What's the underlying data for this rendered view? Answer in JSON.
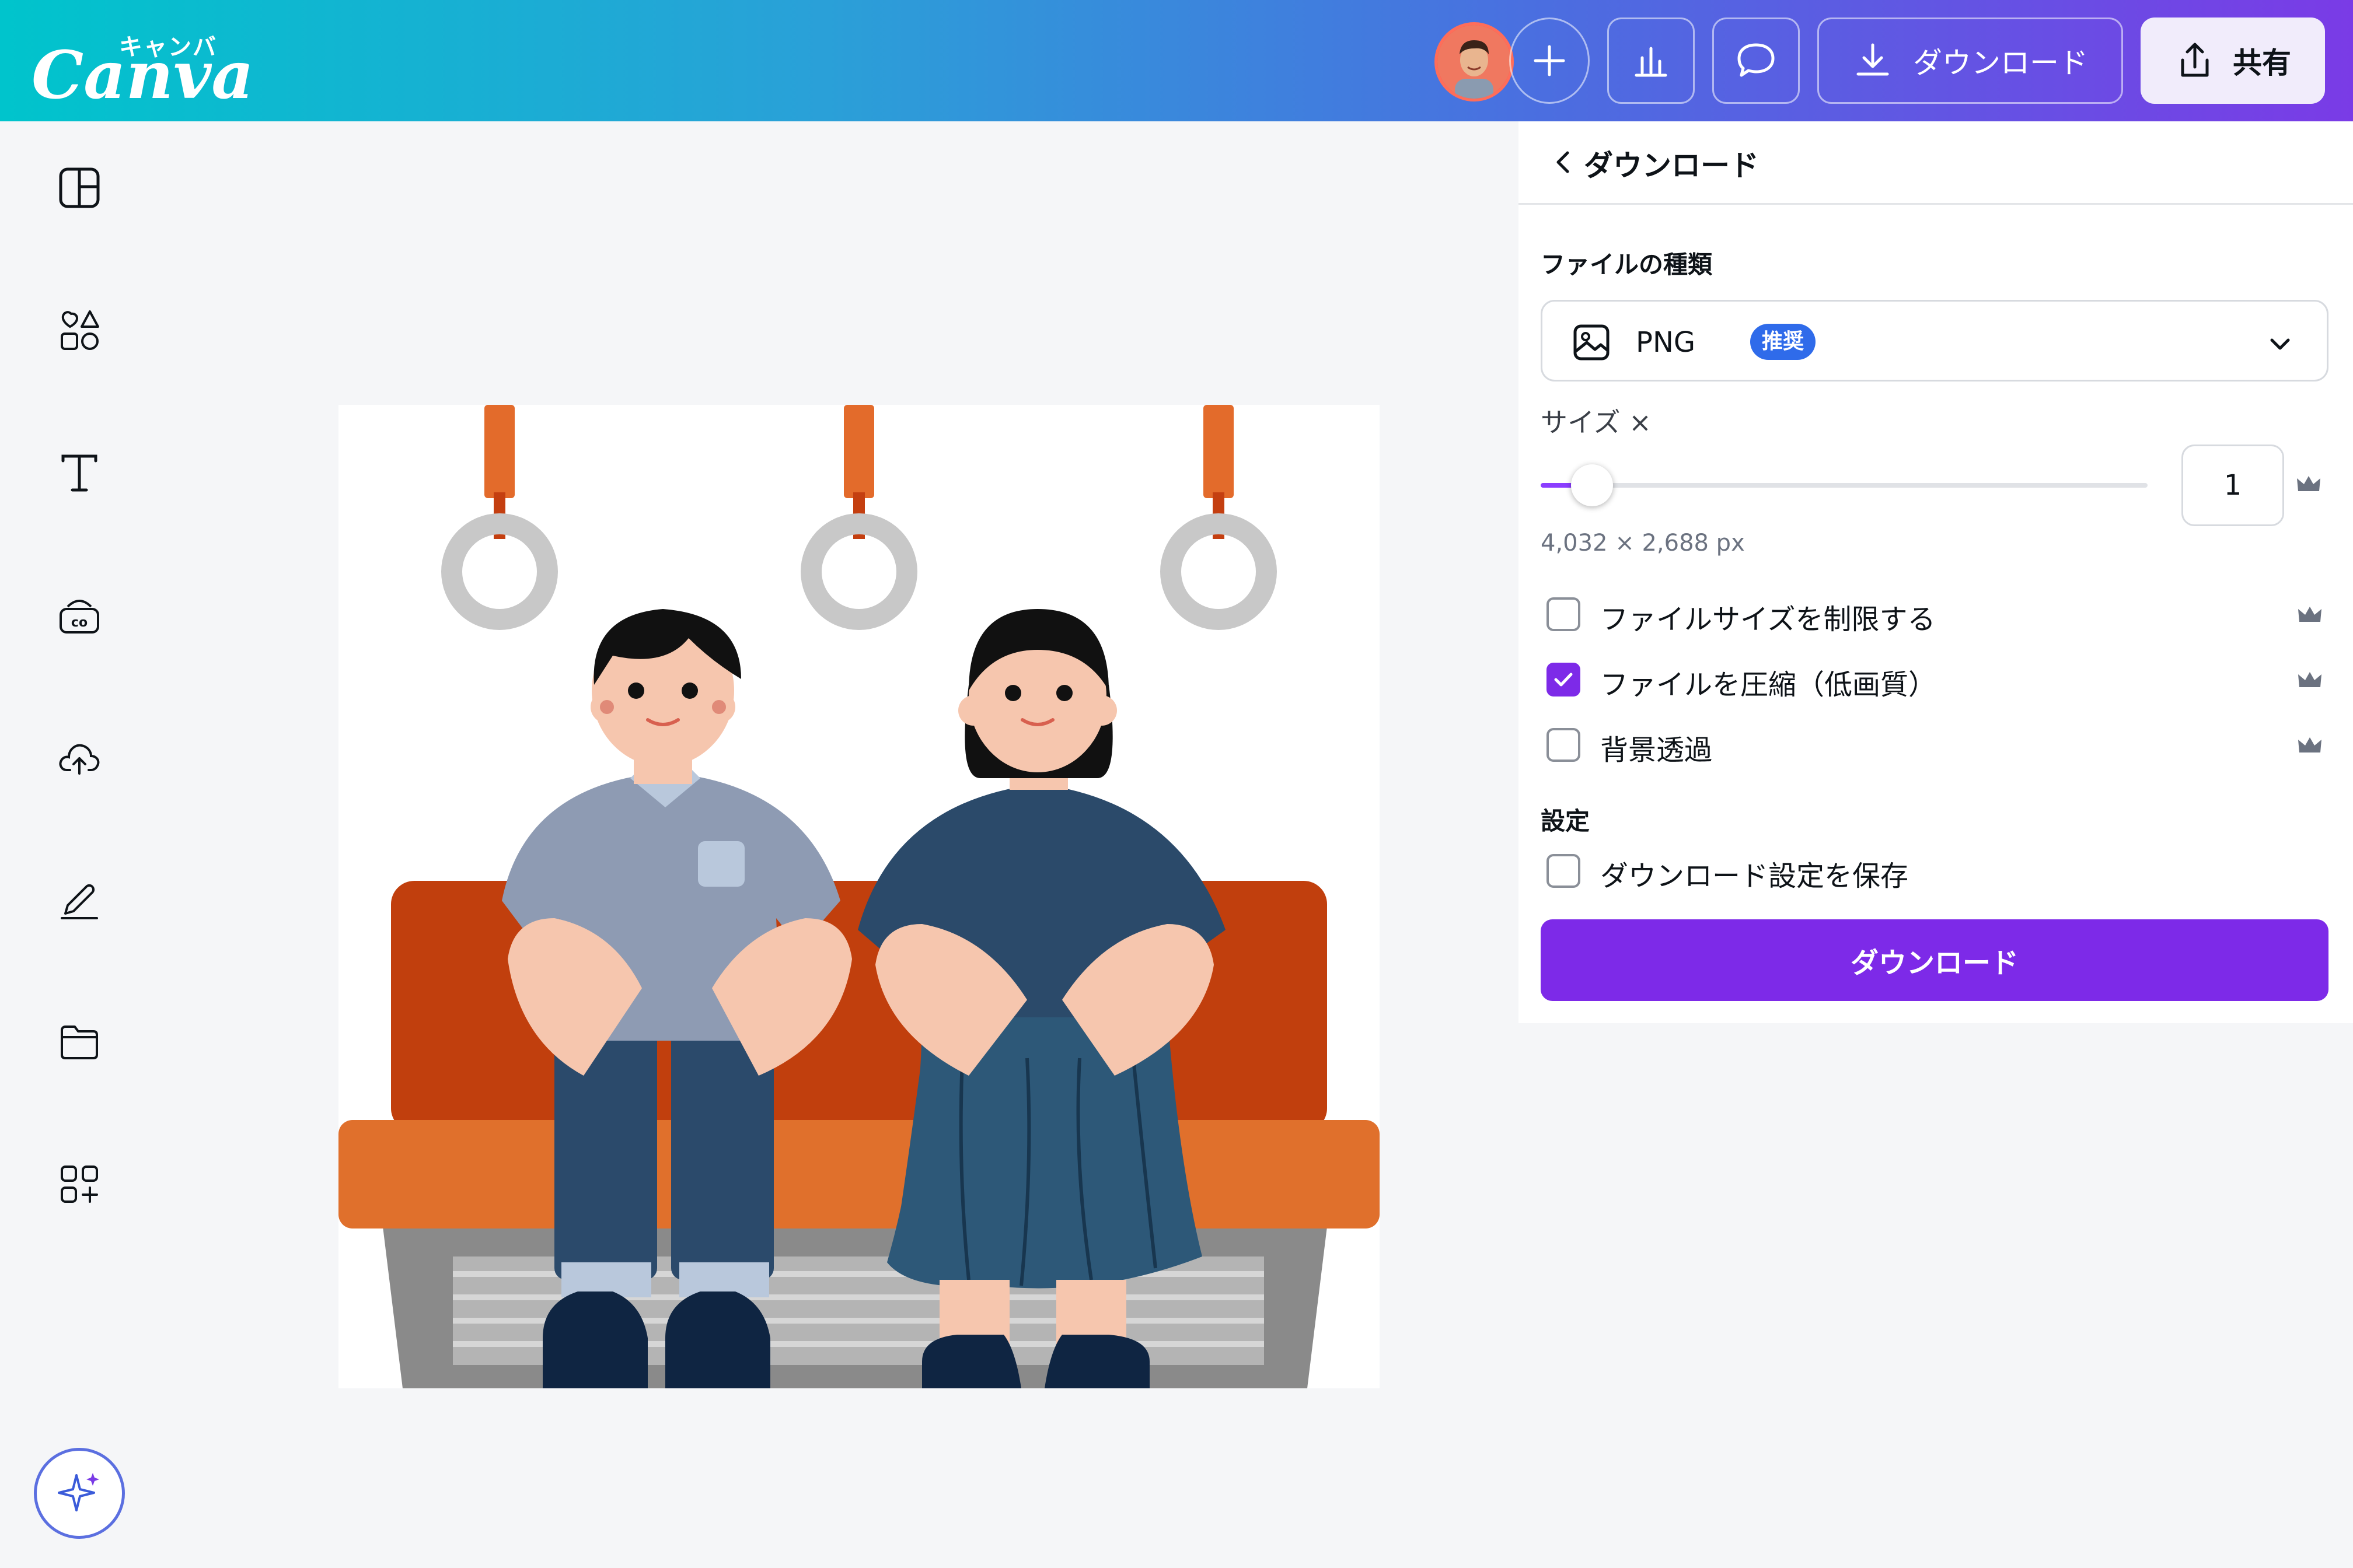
{
  "app": {
    "logo_kana": "キャンバ",
    "logo_word": "Canva"
  },
  "topbar": {
    "download_label": "ダウンロード",
    "share_label": "共有"
  },
  "panel": {
    "title": "ダウンロード",
    "file_type_label": "ファイルの種類",
    "file_type_value": "PNG",
    "file_type_badge": "推奨",
    "size_label": "サイズ ×",
    "size_value": "1",
    "size_slider_fraction": 0.085,
    "dimensions": "4,032 × 2,688 px",
    "options": [
      {
        "label": "ファイルサイズを制限する",
        "checked": false,
        "premium": true
      },
      {
        "label": "ファイルを圧縮（低画質）",
        "checked": true,
        "premium": true
      },
      {
        "label": "背景透過",
        "checked": false,
        "premium": true
      }
    ],
    "settings_label": "設定",
    "save_settings_label": "ダウンロード設定を保存",
    "save_settings_checked": false,
    "download_button": "ダウンロード"
  },
  "colors": {
    "accent_purple": "#7d2ae8",
    "badge_blue": "#2f6bea",
    "gradient_start": "#00c4cc",
    "gradient_end": "#7a3be6"
  },
  "rail_icons": [
    "layout-icon",
    "elements-icon",
    "text-icon",
    "brand-icon",
    "uploads-icon",
    "draw-icon",
    "projects-icon",
    "apps-icon"
  ],
  "design": {
    "description_icons": [
      "strap-handle-icon",
      "man-icon",
      "woman-icon",
      "train-seat-icon"
    ]
  }
}
